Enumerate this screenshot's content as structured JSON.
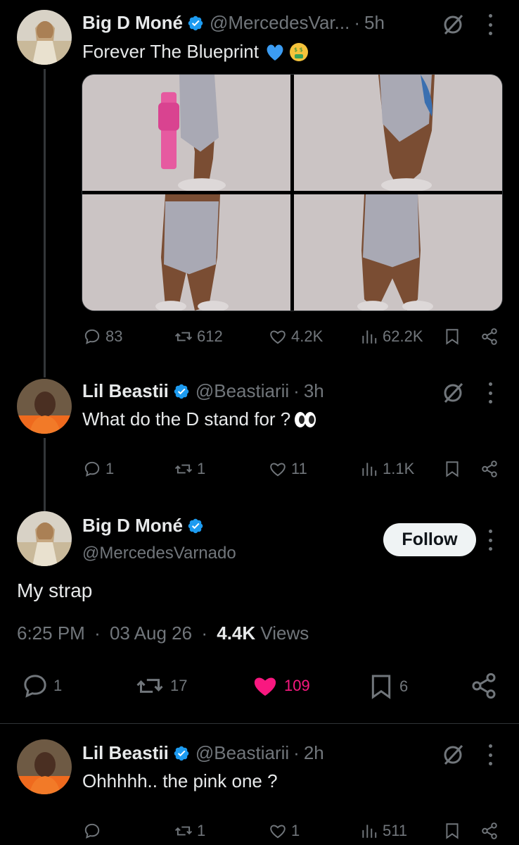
{
  "tweets": [
    {
      "name": "Big D Moné",
      "handle": "@MercedesVar...",
      "time": "5h",
      "text": "Forever The Blueprint",
      "emojis": [
        "blue-heart",
        "money-mouth-face"
      ],
      "replies": "83",
      "reposts": "612",
      "likes": "4.2K",
      "views": "62.2K"
    },
    {
      "name": "Lil Beastii",
      "handle": "@Beastiarii",
      "time": "3h",
      "text": "What do the D stand for ?",
      "emojis": [
        "eyes"
      ],
      "replies": "1",
      "reposts": "1",
      "likes": "11",
      "views": "1.1K"
    },
    {
      "name": "Lil Beastii",
      "handle": "@Beastiarii",
      "time": "2h",
      "text": "Ohhhhh.. the pink one ?",
      "replies": "",
      "reposts": "1",
      "likes": "1",
      "views": "511"
    }
  ],
  "focused": {
    "name": "Big D Moné",
    "handle": "@MercedesVarnado",
    "follow_label": "Follow",
    "text": "My strap",
    "time": "6:25 PM",
    "date": "03 Aug 26",
    "views_count": "4.4K",
    "views_label": "Views",
    "replies": "1",
    "reposts": "17",
    "likes": "109",
    "bookmarks": "6",
    "liked": true
  },
  "dot_separator": "·",
  "colors": {
    "background": "#000000",
    "text": "#e7e9ea",
    "muted": "#71767b",
    "verified": "#1d9bf0",
    "like_active": "#f91880"
  }
}
